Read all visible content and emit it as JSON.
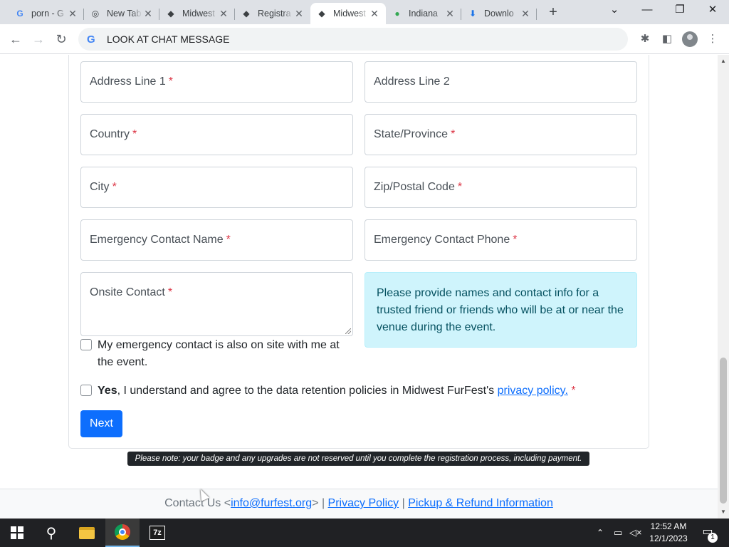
{
  "browser": {
    "tabs": [
      {
        "title": "porn - G",
        "icon": "google-g-icon"
      },
      {
        "title": "New Tab",
        "icon": "chrome-icon"
      },
      {
        "title": "Midwest",
        "icon": "furfest-paw-icon"
      },
      {
        "title": "Registra",
        "icon": "furfest-paw-icon"
      },
      {
        "title": "Midwest",
        "icon": "furfest-paw-icon",
        "active": true
      },
      {
        "title": "Indiana",
        "icon": "maps-pin-icon"
      },
      {
        "title": "Downlo",
        "icon": "download-icon"
      }
    ],
    "address_bar": "LOOK AT CHAT MESSAGE"
  },
  "form": {
    "address_line_1": {
      "label": "Address Line 1",
      "required": "*"
    },
    "address_line_2": {
      "label": "Address Line 2"
    },
    "country": {
      "label": "Country",
      "required": "*"
    },
    "state_province": {
      "label": "State/Province",
      "required": "*"
    },
    "city": {
      "label": "City",
      "required": "*"
    },
    "zip": {
      "label": "Zip/Postal Code",
      "required": "*"
    },
    "emergency_name": {
      "label": "Emergency Contact Name",
      "required": "*"
    },
    "emergency_phone": {
      "label": "Emergency Contact Phone",
      "required": "*"
    },
    "onsite_contact": {
      "label": "Onsite Contact",
      "required": "*"
    },
    "info_text": "Please provide names and contact info for a trusted friend or friends who will be at or near the venue during the event.",
    "onsite_checkbox_label": "My emergency contact is also on site with me at the event.",
    "agree": {
      "yes": "Yes",
      "text": ", I understand and agree to the data retention policies in Midwest FurFest's ",
      "link": "privacy policy.",
      "required": "*"
    },
    "next_button": "Next"
  },
  "notice": "Please note: your badge and any upgrades are not reserved until you complete the registration process, including payment.",
  "footer": {
    "contact_prefix": "Contact Us <",
    "email": "info@furfest.org",
    "contact_suffix": ">",
    "sep": "|",
    "privacy": "Privacy Policy",
    "pickup": "Pickup & Refund Information"
  },
  "taskbar": {
    "time": "12:52 AM",
    "date": "12/1/2023",
    "notification_count": "1",
    "sevenzip_label": "7z"
  }
}
